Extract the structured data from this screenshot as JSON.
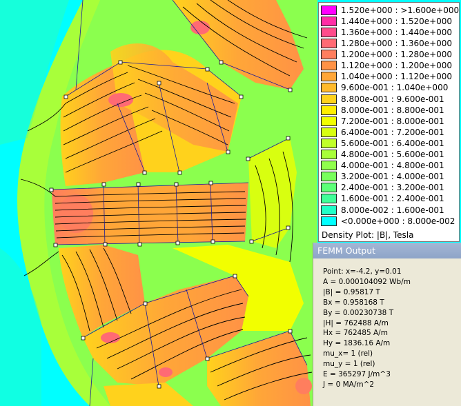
{
  "legend": {
    "entries": [
      {
        "label": "1.520e+000 : >1.600e+000",
        "color": "#ff00ff"
      },
      {
        "label": "1.440e+000 : 1.520e+000",
        "color": "#ff2ea6"
      },
      {
        "label": "1.360e+000 : 1.440e+000",
        "color": "#ff4c8c"
      },
      {
        "label": "1.280e+000 : 1.360e+000",
        "color": "#ff6a74"
      },
      {
        "label": "1.200e+000 : 1.280e+000",
        "color": "#ff7e5e"
      },
      {
        "label": "1.120e+000 : 1.200e+000",
        "color": "#ff9246"
      },
      {
        "label": "1.040e+000 : 1.120e+000",
        "color": "#ffa638"
      },
      {
        "label": "9.600e-001 : 1.040e+000",
        "color": "#ffba2c"
      },
      {
        "label": "8.800e-001 : 9.600e-001",
        "color": "#ffd21c"
      },
      {
        "label": "8.000e-001 : 8.800e-001",
        "color": "#ffee00"
      },
      {
        "label": "7.200e-001 : 8.000e-001",
        "color": "#f2ff00"
      },
      {
        "label": "6.400e-001 : 7.200e-001",
        "color": "#d8ff10"
      },
      {
        "label": "5.600e-001 : 6.400e-001",
        "color": "#c0ff28"
      },
      {
        "label": "4.800e-001 : 5.600e-001",
        "color": "#a8ff3a"
      },
      {
        "label": "4.000e-001 : 4.800e-001",
        "color": "#90ff4c"
      },
      {
        "label": "3.200e-001 : 4.000e-001",
        "color": "#78ff5c"
      },
      {
        "label": "2.400e-001 : 3.200e-001",
        "color": "#5cff78"
      },
      {
        "label": "1.600e-001 : 2.400e-001",
        "color": "#40ff98"
      },
      {
        "label": "8.000e-002 : 1.600e-001",
        "color": "#20ffc8"
      },
      {
        "label": "<0.000e+000 : 8.000e-002",
        "color": "#00ffff"
      }
    ],
    "caption": "Density Plot: |B|, Tesla"
  },
  "output": {
    "title": "FEMM Output",
    "lines": [
      "Point: x=-4.2, y=0.01",
      "A  = 0.000104092 Wb/m",
      "|B| = 0.95817 T",
      "Bx  = 0.958168 T",
      "By  = 0.00230738 T",
      "|H| = 762488 A/m",
      "Hx  = 762485 A/m",
      "Hy  = 1836.16 A/m",
      "mu_x= 1 (rel)",
      "mu_y = 1 (rel)",
      "E  = 365297 J/m^3",
      "J  = 0 MA/m^2"
    ]
  },
  "colors": {
    "background": "#00ffff",
    "field_low": "#7dff5a",
    "field_mid": "#ffee00",
    "field_high": "#ffa638",
    "field_peak": "#ff6a74",
    "mesh": "#1a1a9a",
    "titlebar": "#8ea4c8",
    "panel": "#ece9d8"
  }
}
